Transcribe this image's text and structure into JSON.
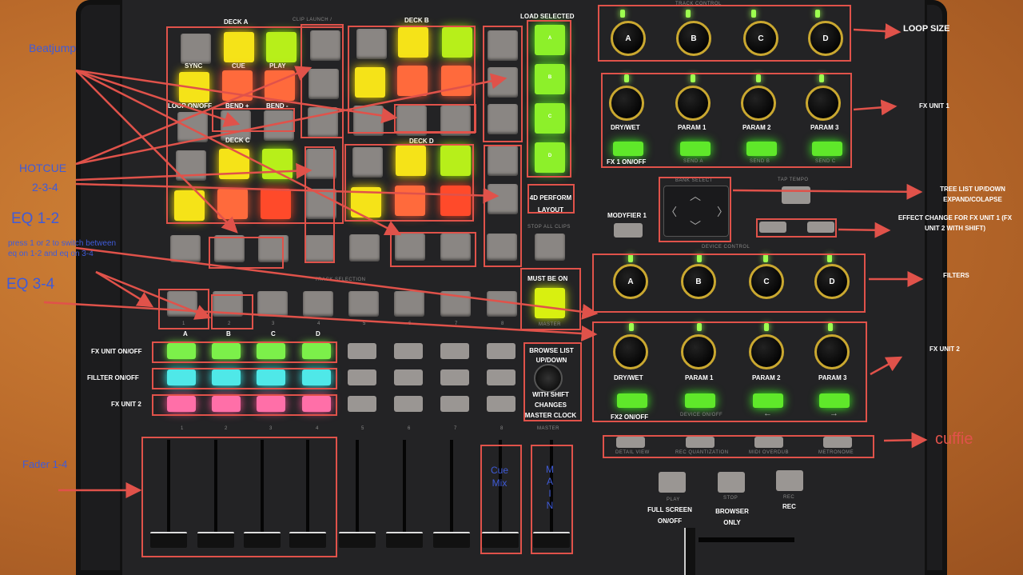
{
  "sections": {
    "deck_a": "DECK A",
    "deck_b": "DECK B",
    "deck_c": "DECK C",
    "deck_d": "DECK D",
    "clip_launch": "CLIP LAUNCH /",
    "load_selected": "LOAD SELECTED",
    "track_control": "TRACK CONTROL",
    "device_control": "DEVICE CONTROL",
    "track_selection": "TRACK SELECTION",
    "bank_select": "BANK SELECT",
    "tap_tempo": "TAP TEMPO",
    "master": "MASTER",
    "stop_all_clips": "STOP ALL CLIPS"
  },
  "deck_a_labels": [
    "SYNC",
    "CUE",
    "PLAY"
  ],
  "bend_labels": [
    "LOOP ON/OFF",
    "BEND +",
    "BEND -"
  ],
  "load_pads": [
    "A",
    "B",
    "C",
    "D"
  ],
  "perform_layout": "4D PERFORM LAYOUT",
  "must_be_on": "MUST BE ON",
  "modyfier": "MODYFIER 1",
  "loop_knobs": [
    "A",
    "B",
    "C",
    "D"
  ],
  "loop_size": "LOOP SIZE",
  "fx1_labels": [
    "DRY/WET",
    "PARAM 1",
    "PARAM 2",
    "PARAM 3"
  ],
  "fx1_onoff": "FX 1 ON/OFF",
  "fx1_send": [
    "SEND A",
    "SEND B",
    "SEND C"
  ],
  "fx_unit_1": "FX UNIT 1",
  "filter_knobs": [
    "A",
    "B",
    "C",
    "D"
  ],
  "filters": "FILTERS",
  "fx2_labels": [
    "DRY/WET",
    "PARAM 1",
    "PARAM 2",
    "PARAM 3"
  ],
  "fx2_onoff": "FX2 ON/OFF",
  "fx2_sub": [
    "DEVICE ON/OFF"
  ],
  "fx_unit_2": "FX UNIT 2",
  "tree_list": "TREE LIST UP/DOWN EXPAND/COLAPSE",
  "effect_change": "EFFECT CHANGE FOR FX UNIT 1 (FX UNIT 2 WITH SHIFT)",
  "track_numbers": [
    "1",
    "2",
    "3",
    "4",
    "5",
    "6",
    "7",
    "8"
  ],
  "track_letters": [
    "A",
    "B",
    "C",
    "D"
  ],
  "row_labels": [
    "FX UNIT ON/OFF",
    "FILLTER ON/OFF",
    "FX UNIT 2"
  ],
  "browse": "BROWSE LIST UP/DOWN",
  "browse_shift": "WITH SHIFT CHANGES MASTER CLOCK",
  "bottom_small": [
    "DETAIL VIEW",
    "REC QUANTIZATION",
    "MIDI OVERDUB",
    "METRONOME"
  ],
  "cuffie": "cuffie",
  "transport": [
    "PLAY",
    "STOP",
    "REC"
  ],
  "transport_notes": [
    "FULL SCREEN ON/OFF",
    "BROWSER ONLY",
    "REC"
  ],
  "annotations_left": {
    "beatjump": "Beatjump",
    "hotcue": "HOTCUE",
    "hotcue_nums": "2-3-4",
    "eq12": "EQ 1-2",
    "eq_note": "press 1 or 2 to switch between eq on 1-2 and eq on 3-4",
    "eq34": "EQ 3-4",
    "fader": "Fader 1-4"
  },
  "cue_mix": [
    "Cue",
    "Mix"
  ],
  "main": [
    "M",
    "A",
    "I",
    "N"
  ]
}
